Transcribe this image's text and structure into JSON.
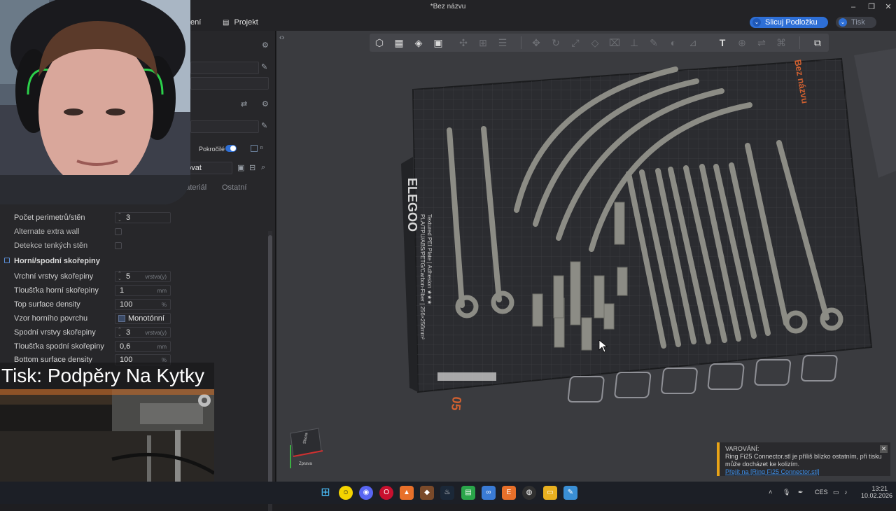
{
  "window": {
    "title": "*Bez názvu"
  },
  "menubar": {
    "items": [
      {
        "label": "ení"
      },
      {
        "label": "Projekt"
      }
    ],
    "slice_button": "Slicuj Podložku",
    "print_button": "Tisk"
  },
  "left_panel": {
    "advanced_label": "Pokročilé",
    "process_preset": "irovat",
    "tabs": [
      "ultimateriál",
      "Ostatní"
    ],
    "params": [
      {
        "label": "Počet perimetrů/stěn",
        "value": "3",
        "unit": ""
      },
      {
        "label": "Alternate extra wall",
        "value": "",
        "unit": ""
      },
      {
        "label": "Detekce tenkých stěn",
        "value": "",
        "unit": ""
      }
    ],
    "section_title": "Horní/spodní skořepiny",
    "shell_params": [
      {
        "label": "Vrchní vrstvy skořepiny",
        "value": "5",
        "unit": "vrstva(y)"
      },
      {
        "label": "Tloušťka horní skořepiny",
        "value": "1",
        "unit": "mm"
      },
      {
        "label": "Top surface density",
        "value": "100",
        "unit": "%"
      },
      {
        "label": "Vzor horního povrchu",
        "value": "Monotónní ...",
        "unit": ""
      },
      {
        "label": "Spodní vrstvy skořepiny",
        "value": "3",
        "unit": "vrstva(y)"
      },
      {
        "label": "Tloušťka spodní skořepiny",
        "value": "0,6",
        "unit": "mm"
      },
      {
        "label": "Bottom surface density",
        "value": "100",
        "unit": "%"
      }
    ]
  },
  "viewport": {
    "plate_name": "Bez názvu",
    "plate_number": "05",
    "plate_brand": "ELEGOO",
    "plate_text": "PLA/TPU/ABS/PETG/Carbon-Fiber | 256×256mm²",
    "plate_text2": "Textured PEI Plate | Adhesion ★★★",
    "nav_cube": {
      "top": "Shora",
      "front": "Zprava"
    }
  },
  "overlay": {
    "title": "Tisk: Podpěry Na Kytky"
  },
  "warning": {
    "title": "VAROVÁNÍ:",
    "message": "Ring Fi25 Connector.stl je příliš blízko ostatním, při tisku může docházet ke kolizím.",
    "link": "Přejít na [Ring Fi25 Connector.stl]"
  },
  "taskbar": {
    "lang": "CES",
    "time": "13:21",
    "date": "10.02.2026"
  },
  "colors": {
    "accent": "#2e6fd6",
    "warning": "#e8a317",
    "plate": "#2b2c30",
    "model": "#8c8c85"
  }
}
